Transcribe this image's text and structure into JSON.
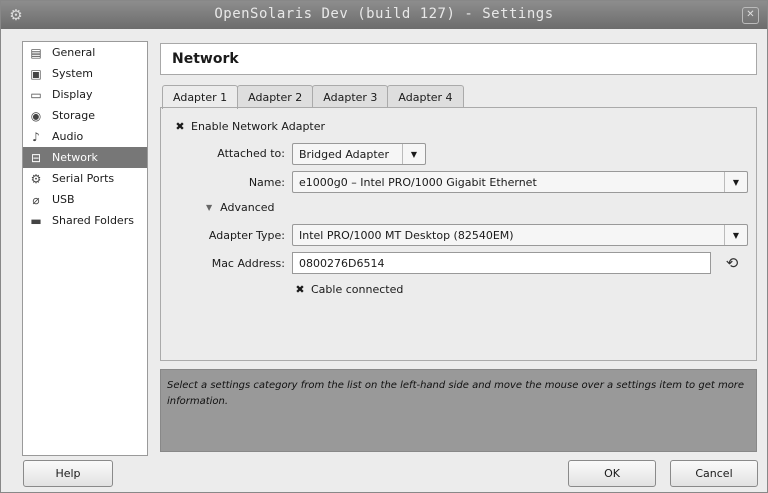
{
  "window": {
    "title": "OpenSolaris Dev (build 127) - Settings"
  },
  "sidebar": {
    "items": [
      {
        "label": "General",
        "icon": "general-icon"
      },
      {
        "label": "System",
        "icon": "system-icon"
      },
      {
        "label": "Display",
        "icon": "display-icon"
      },
      {
        "label": "Storage",
        "icon": "storage-icon"
      },
      {
        "label": "Audio",
        "icon": "audio-icon"
      },
      {
        "label": "Network",
        "icon": "network-icon",
        "selected": true
      },
      {
        "label": "Serial Ports",
        "icon": "serial-ports-icon"
      },
      {
        "label": "USB",
        "icon": "usb-icon"
      },
      {
        "label": "Shared Folders",
        "icon": "shared-folders-icon"
      }
    ]
  },
  "header": {
    "title": "Network"
  },
  "tabs": [
    {
      "label": "Adapter 1",
      "active": true
    },
    {
      "label": "Adapter 2"
    },
    {
      "label": "Adapter 3"
    },
    {
      "label": "Adapter 4"
    }
  ],
  "adapter": {
    "enable_label": "Enable Network Adapter",
    "enable_checked": true,
    "attached_label": "Attached to:",
    "attached_value": "Bridged Adapter",
    "name_label": "Name:",
    "name_value": "e1000g0 – Intel PRO/1000 Gigabit Ethernet",
    "advanced_label": "Advanced",
    "type_label": "Adapter Type:",
    "type_value": "Intel PRO/1000 MT Desktop (82540EM)",
    "mac_label": "Mac Address:",
    "mac_value": "0800276D6514",
    "cable_label": "Cable connected",
    "cable_checked": true
  },
  "info": {
    "text": "Select a settings category from the list on the left-hand side and move the mouse over a settings item to get more information."
  },
  "buttons": {
    "help": "Help",
    "ok": "OK",
    "cancel": "Cancel"
  }
}
